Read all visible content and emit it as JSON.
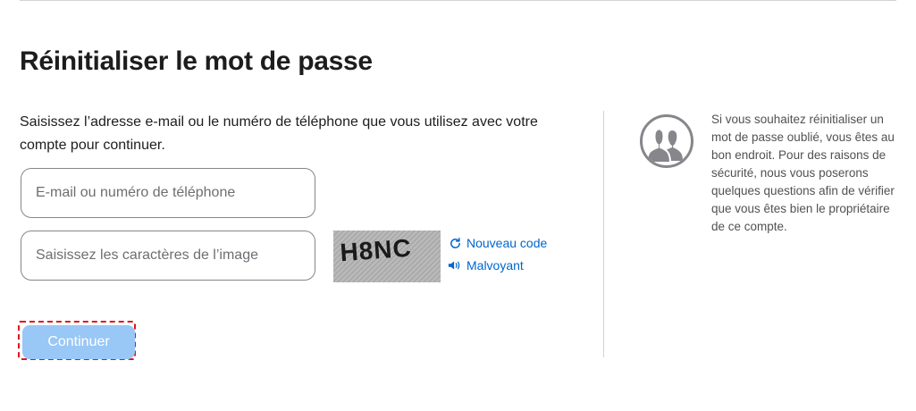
{
  "page": {
    "title": "Réinitialiser le mot de passe",
    "instructions": "Saisissez l’adresse e-mail ou le numéro de téléphone que vous utilisez avec votre compte pour continuer."
  },
  "form": {
    "email_placeholder": "E-mail ou numéro de téléphone",
    "email_value": "",
    "captcha_placeholder": "Saisissez les caractères de l’image",
    "captcha_value": "",
    "captcha_text": "H8NC",
    "new_code_label": "Nouveau code",
    "audio_label": "Malvoyant",
    "continue_label": "Continuer"
  },
  "sidebar": {
    "help_text": "Si vous souhaitez réinitialiser un mot de passe oublié, vous êtes au bon endroit. Pour des raisons de sécurité, nous vous poserons quelques questions afin de vérifier que vous êtes bien le propriétaire de ce compte."
  },
  "colors": {
    "link": "#0066cc",
    "button_disabled": "#99c7f6",
    "highlight_border": "#e0141e",
    "icon_gray": "#86868b"
  },
  "icons": {
    "refresh": "refresh-icon",
    "speaker": "speaker-icon",
    "help": "people-icon"
  }
}
